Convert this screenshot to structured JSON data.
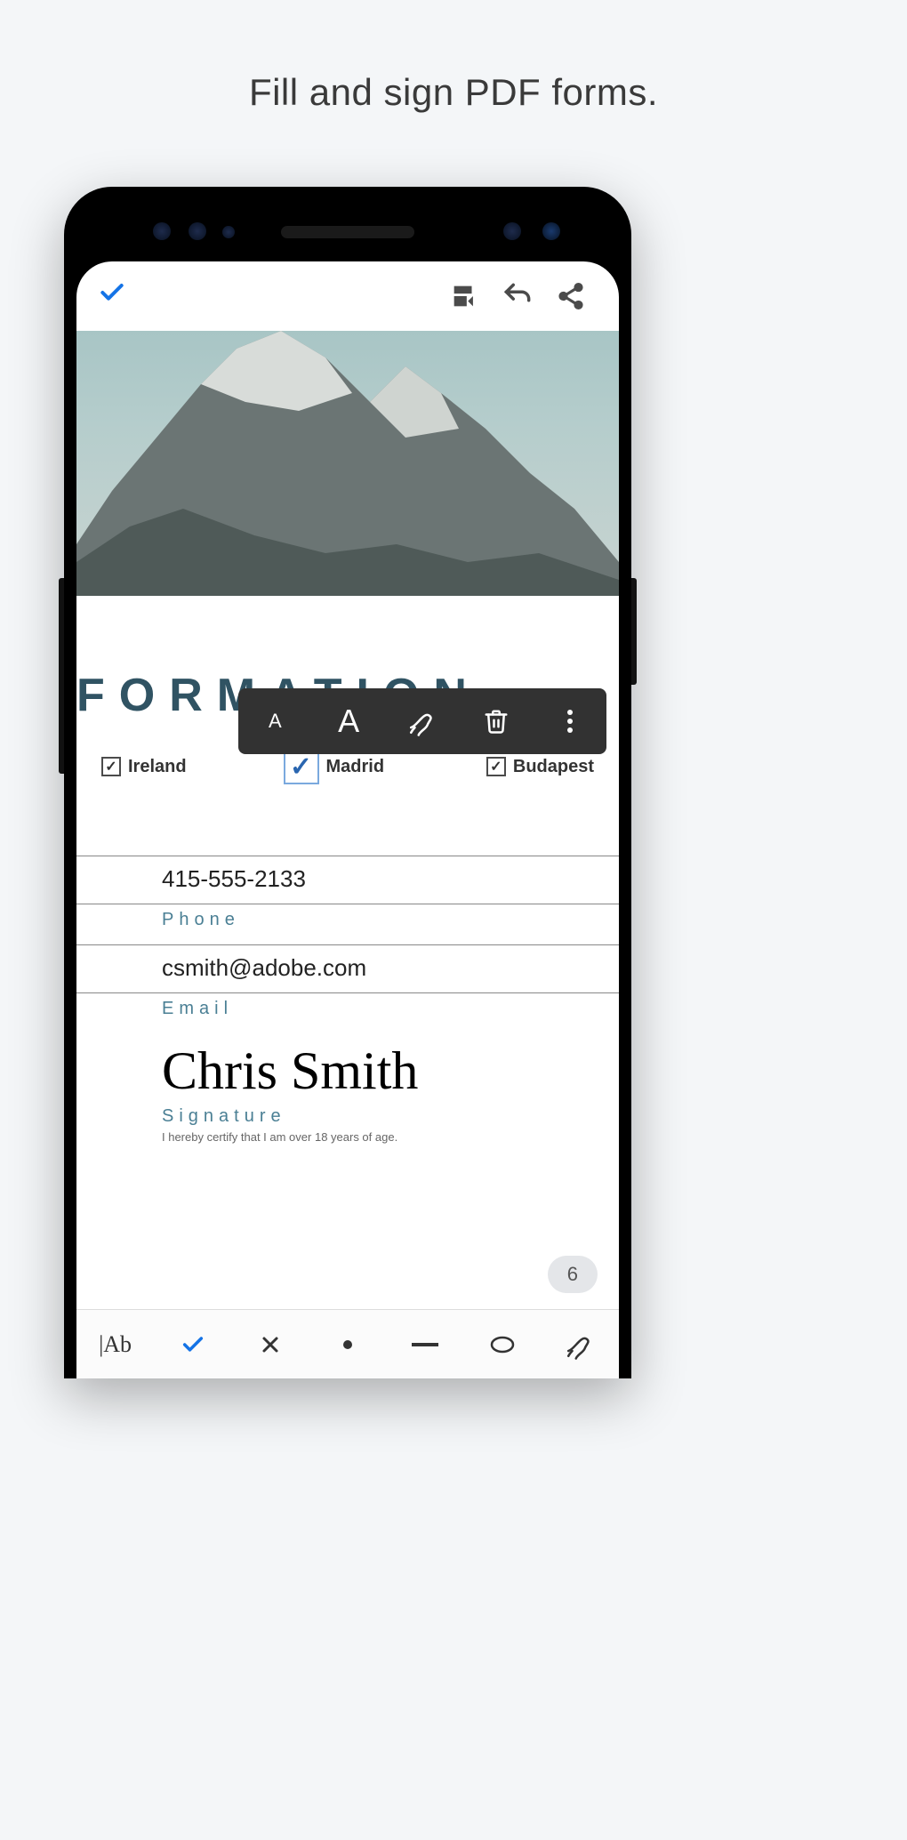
{
  "headline": "Fill and sign PDF forms.",
  "topbar": {
    "done_icon": "check-icon",
    "actions": [
      "file-icon",
      "undo-icon",
      "share-icon"
    ]
  },
  "tray": {
    "items": [
      "text-small-icon",
      "text-large-icon",
      "pen-icon",
      "trash-icon",
      "more-icon"
    ]
  },
  "form": {
    "heading": "FORMATION",
    "checkboxes": [
      {
        "label": "Ireland",
        "checked": true,
        "selected": false
      },
      {
        "label": "Madrid",
        "checked": true,
        "selected": true
      },
      {
        "label": "Budapest",
        "checked": true,
        "selected": false
      }
    ],
    "fields": [
      {
        "value": "415-555-2133",
        "label": "Phone"
      },
      {
        "value": "csmith@adobe.com",
        "label": "Email"
      }
    ],
    "signature": {
      "value": "Chris Smith",
      "label": "Signature",
      "disclaimer": "I hereby certify that I am over 18 years of age."
    }
  },
  "page_number": "6",
  "bottom_tools": [
    "text-tool",
    "check-icon",
    "x-icon",
    "dot-icon",
    "dash-icon",
    "circle-icon",
    "signature-icon"
  ]
}
